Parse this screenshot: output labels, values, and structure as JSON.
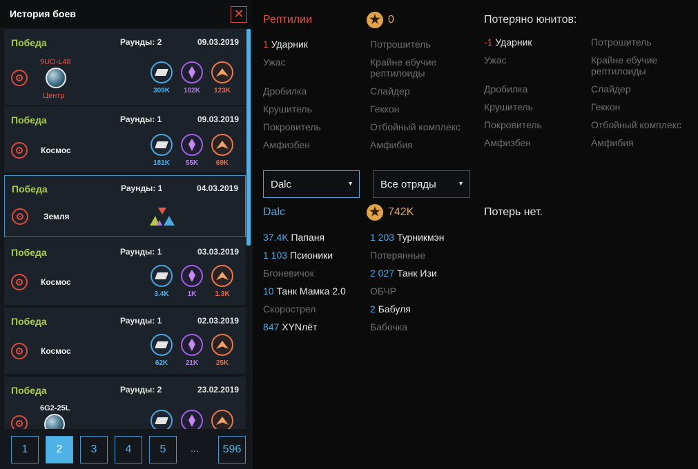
{
  "history": {
    "title": "История боев",
    "close_icon": "close-icon",
    "battles": [
      {
        "result": "Победа",
        "rounds": "Раунды: 2",
        "date": "09.03.2019",
        "coords": "9UO-L48",
        "location": "Центр",
        "metal": "309K",
        "crystal": "102K",
        "gas": "123K"
      },
      {
        "result": "Победа",
        "rounds": "Раунды: 1",
        "date": "09.03.2019",
        "location": "Космос",
        "metal": "181K",
        "crystal": "55K",
        "gas": "69K"
      },
      {
        "result": "Победа",
        "rounds": "Раунды: 1",
        "date": "04.03.2019",
        "location": "Земля"
      },
      {
        "result": "Победа",
        "rounds": "Раунды: 1",
        "date": "03.03.2019",
        "location": "Космос",
        "metal": "3.4K",
        "crystal": "1K",
        "gas": "1.3K"
      },
      {
        "result": "Победа",
        "rounds": "Раунды: 1",
        "date": "02.03.2019",
        "location": "Космос",
        "metal": "62K",
        "crystal": "21K",
        "gas": "25K"
      },
      {
        "result": "Победа",
        "rounds": "Раунды: 2",
        "date": "23.02.2019",
        "coords": "6G2-25L"
      }
    ]
  },
  "pagination": {
    "pages": [
      "1",
      "2",
      "3",
      "4",
      "5"
    ],
    "ellipsis": "...",
    "last": "596",
    "active": "2"
  },
  "enemy": {
    "name": "Рептилии",
    "score": "0",
    "units": [
      {
        "count": "1",
        "name": "Ударник"
      },
      {
        "name": "Потрошитель"
      },
      {
        "name": "Ужас"
      },
      {
        "name": "Крайне ебучие рептилоиды"
      },
      {
        "name": "Дробилка"
      },
      {
        "name": "Слайдер"
      },
      {
        "name": "Крушитель"
      },
      {
        "name": "Геккон"
      },
      {
        "name": "Покровитель"
      },
      {
        "name": "Отбойный комплекс"
      },
      {
        "name": "Амфизбен"
      },
      {
        "name": "Амфибия"
      }
    ]
  },
  "enemy_losses": {
    "title": "Потеряно юнитов:",
    "units": [
      {
        "count": "-1",
        "name": "Ударник"
      },
      {
        "name": "Потрошитель"
      },
      {
        "name": "Ужас"
      },
      {
        "name": "Крайне ебучие рептилоиды"
      },
      {
        "name": "Дробилка"
      },
      {
        "name": "Слайдер"
      },
      {
        "name": "Крушитель"
      },
      {
        "name": "Геккон"
      },
      {
        "name": "Покровитель"
      },
      {
        "name": "Отбойный комплекс"
      },
      {
        "name": "Амфизбен"
      },
      {
        "name": "Амфибия"
      }
    ]
  },
  "filters": {
    "player": "Dalc",
    "squads": "Все отряды"
  },
  "ally": {
    "name": "Dalc",
    "score": "742K",
    "units": [
      {
        "count": "37.4K",
        "name": "Папаня"
      },
      {
        "count": "1 203",
        "name": "Турникмэн"
      },
      {
        "count": "1 103",
        "name": "Псионики"
      },
      {
        "name": "Потерянные"
      },
      {
        "name": "Бгоневичок"
      },
      {
        "count": "2 027",
        "name": "Танк Изи"
      },
      {
        "count": "10",
        "name": "Танк Мамка 2.0"
      },
      {
        "name": "ОБЧР"
      },
      {
        "name": "Скорострел"
      },
      {
        "count": "2",
        "name": "Бабуля"
      },
      {
        "count": "847",
        "name": "XYNлёт"
      },
      {
        "name": "Бабочка"
      }
    ]
  },
  "ally_losses": {
    "text": "Потерь нет."
  },
  "colors": {
    "accent": "#4fb2e6",
    "victory": "#a9cb4f",
    "enemy": "#e0523f"
  }
}
